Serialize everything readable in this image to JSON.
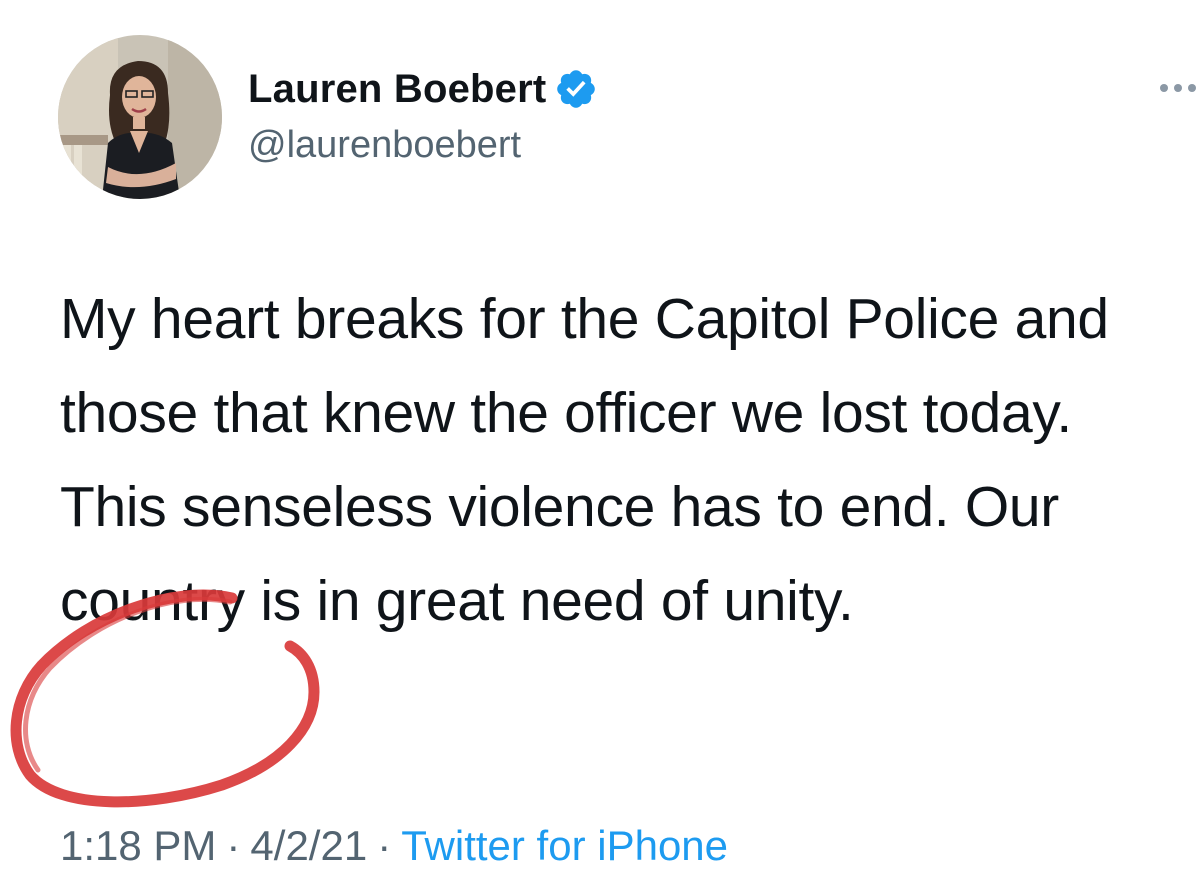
{
  "tweet": {
    "author": {
      "display_name": "Lauren Boebert",
      "handle": "@laurenboebert",
      "verified": true
    },
    "text": "My heart breaks for the Capitol Police and those that knew the officer we lost today. This senseless violence has to end. Our country is in great need of unity.",
    "time": "1:18 PM",
    "date": "4/2/21",
    "separator": "·",
    "source": "Twitter for iPhone"
  },
  "colors": {
    "verified_badge": "#1d9bf0",
    "source_link": "#1d9bf0",
    "secondary_text": "#536471",
    "annotation_circle": "#d93a3a"
  },
  "icons": {
    "verified": "verified-badge-icon",
    "more": "more-options-icon"
  }
}
